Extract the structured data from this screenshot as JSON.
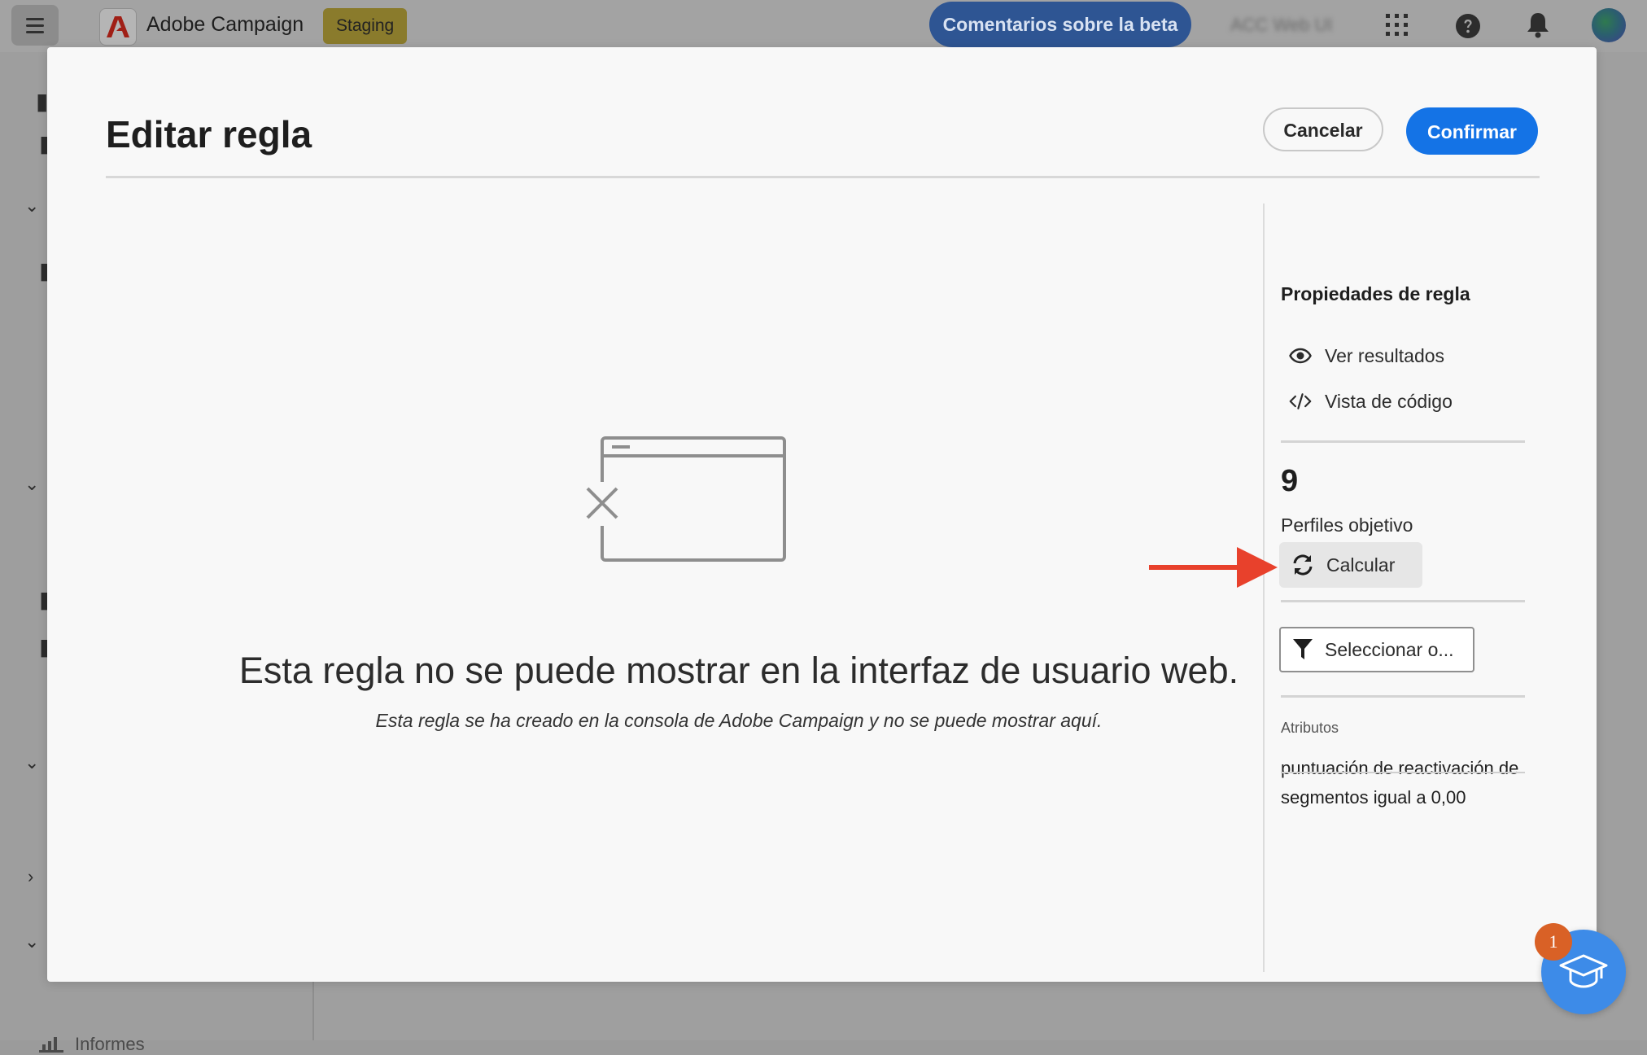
{
  "topbar": {
    "app_name": "Adobe Campaign",
    "environment_badge": "Staging",
    "beta_feedback_label": "Comentarios sobre la beta",
    "user_label": "ACC Web UI"
  },
  "sidebar": {
    "reports_label": "Informes"
  },
  "modal": {
    "title": "Editar regla",
    "cancel_label": "Cancelar",
    "confirm_label": "Confirmar",
    "empty_state": {
      "title": "Esta regla no se puede mostrar en la interfaz de usuario web.",
      "subtitle": "Esta regla se ha creado en la consola de Adobe Campaign y no se puede mostrar aquí."
    },
    "panel": {
      "title": "Propiedades de regla",
      "view_results_label": "Ver resultados",
      "code_view_label": "Vista de código",
      "target_count": "9",
      "target_count_label": "Perfiles objetivo",
      "calculate_label": "Calcular",
      "select_label": "Seleccionar o...",
      "attributes_label": "Atributos",
      "attributes_value": "puntuación de reactivación de segmentos igual a 0,00"
    }
  },
  "help_fab": {
    "badge_count": "1"
  },
  "colors": {
    "accent": "#1473e6",
    "annotation_arrow": "#e8412c",
    "beta_button": "#2e5593",
    "staging_badge": "#8a7b2c",
    "fab": "#3d8be8",
    "fab_badge": "#d96126"
  }
}
